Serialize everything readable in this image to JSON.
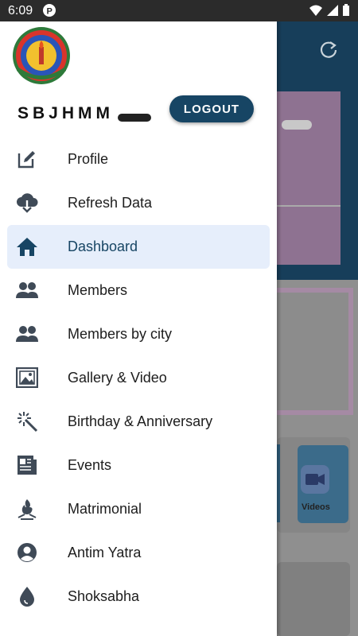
{
  "status_bar": {
    "time": "6:09"
  },
  "drawer": {
    "username": "SBJHMM",
    "logout_label": "LOGOUT",
    "items": [
      {
        "label": "Profile",
        "icon": "edit-icon",
        "active": false
      },
      {
        "label": "Refresh Data",
        "icon": "cloud-download-icon",
        "active": false
      },
      {
        "label": "Dashboard",
        "icon": "home-icon",
        "active": true
      },
      {
        "label": "Members",
        "icon": "people-icon",
        "active": false
      },
      {
        "label": "Members by city",
        "icon": "people-icon",
        "active": false
      },
      {
        "label": "Gallery & Video",
        "icon": "gallery-icon",
        "active": false
      },
      {
        "label": "Birthday & Anniversary",
        "icon": "magic-wand-icon",
        "active": false
      },
      {
        "label": "Events",
        "icon": "newspaper-icon",
        "active": false
      },
      {
        "label": "Matrimonial",
        "icon": "fire-icon",
        "active": false
      },
      {
        "label": "Antim Yatra",
        "icon": "account-circle-icon",
        "active": false
      },
      {
        "label": "Shoksabha",
        "icon": "drop-icon",
        "active": false
      }
    ]
  },
  "background": {
    "tile_label": "Videos"
  },
  "colors": {
    "accent": "#174564",
    "active_bg": "#e6eefb",
    "icon": "#3f4a57"
  }
}
